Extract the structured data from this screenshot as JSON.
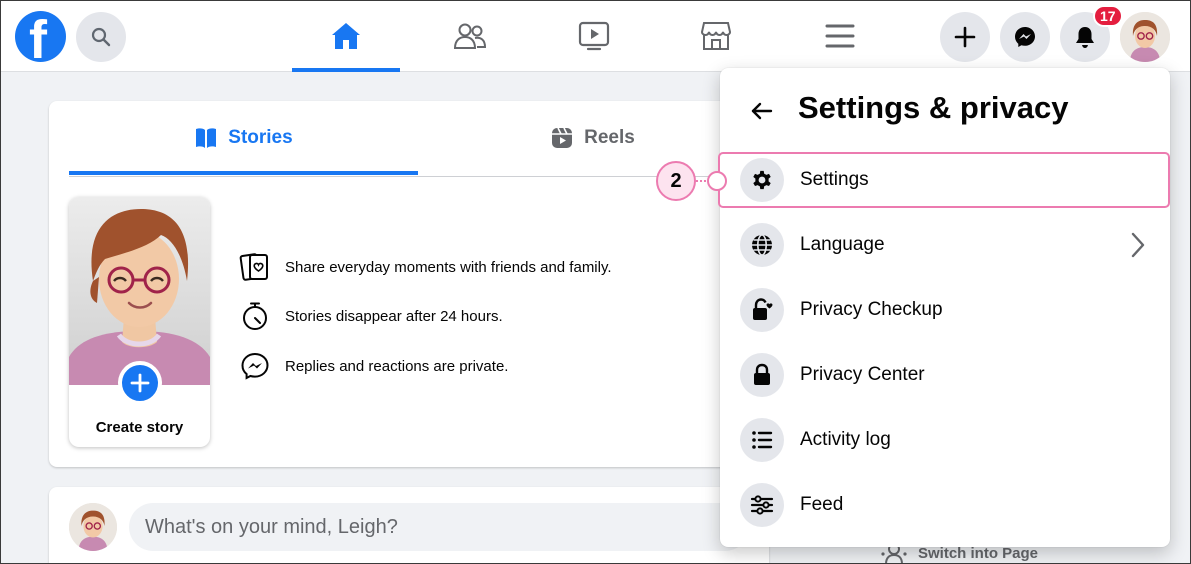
{
  "topbar": {
    "logo_letter": "f",
    "notification_count": "17",
    "nav": [
      "home",
      "friends",
      "watch",
      "marketplace",
      "menu"
    ]
  },
  "stories": {
    "tabs": [
      "Stories",
      "Reels"
    ],
    "create_story_label": "Create story",
    "info": [
      "Share everyday moments with friends and family.",
      "Stories disappear after 24 hours.",
      "Replies and reactions are private."
    ]
  },
  "composer": {
    "placeholder": "What's on your mind, Leigh?"
  },
  "sidebar": {
    "switch_page_label": "Switch into Page"
  },
  "dropdown": {
    "title": "Settings & privacy",
    "items": [
      {
        "label": "Settings",
        "icon": "gear-icon"
      },
      {
        "label": "Language",
        "icon": "globe-icon"
      },
      {
        "label": "Privacy Checkup",
        "icon": "lock-heart-icon"
      },
      {
        "label": "Privacy Center",
        "icon": "lock-icon"
      },
      {
        "label": "Activity log",
        "icon": "list-icon"
      },
      {
        "label": "Feed",
        "icon": "sliders-icon"
      }
    ]
  },
  "annotation": {
    "step_number": "2"
  },
  "colors": {
    "brand_blue": "#1877f2",
    "highlight_pink": "#ec7bb0",
    "badge_red": "#e41e3f"
  }
}
